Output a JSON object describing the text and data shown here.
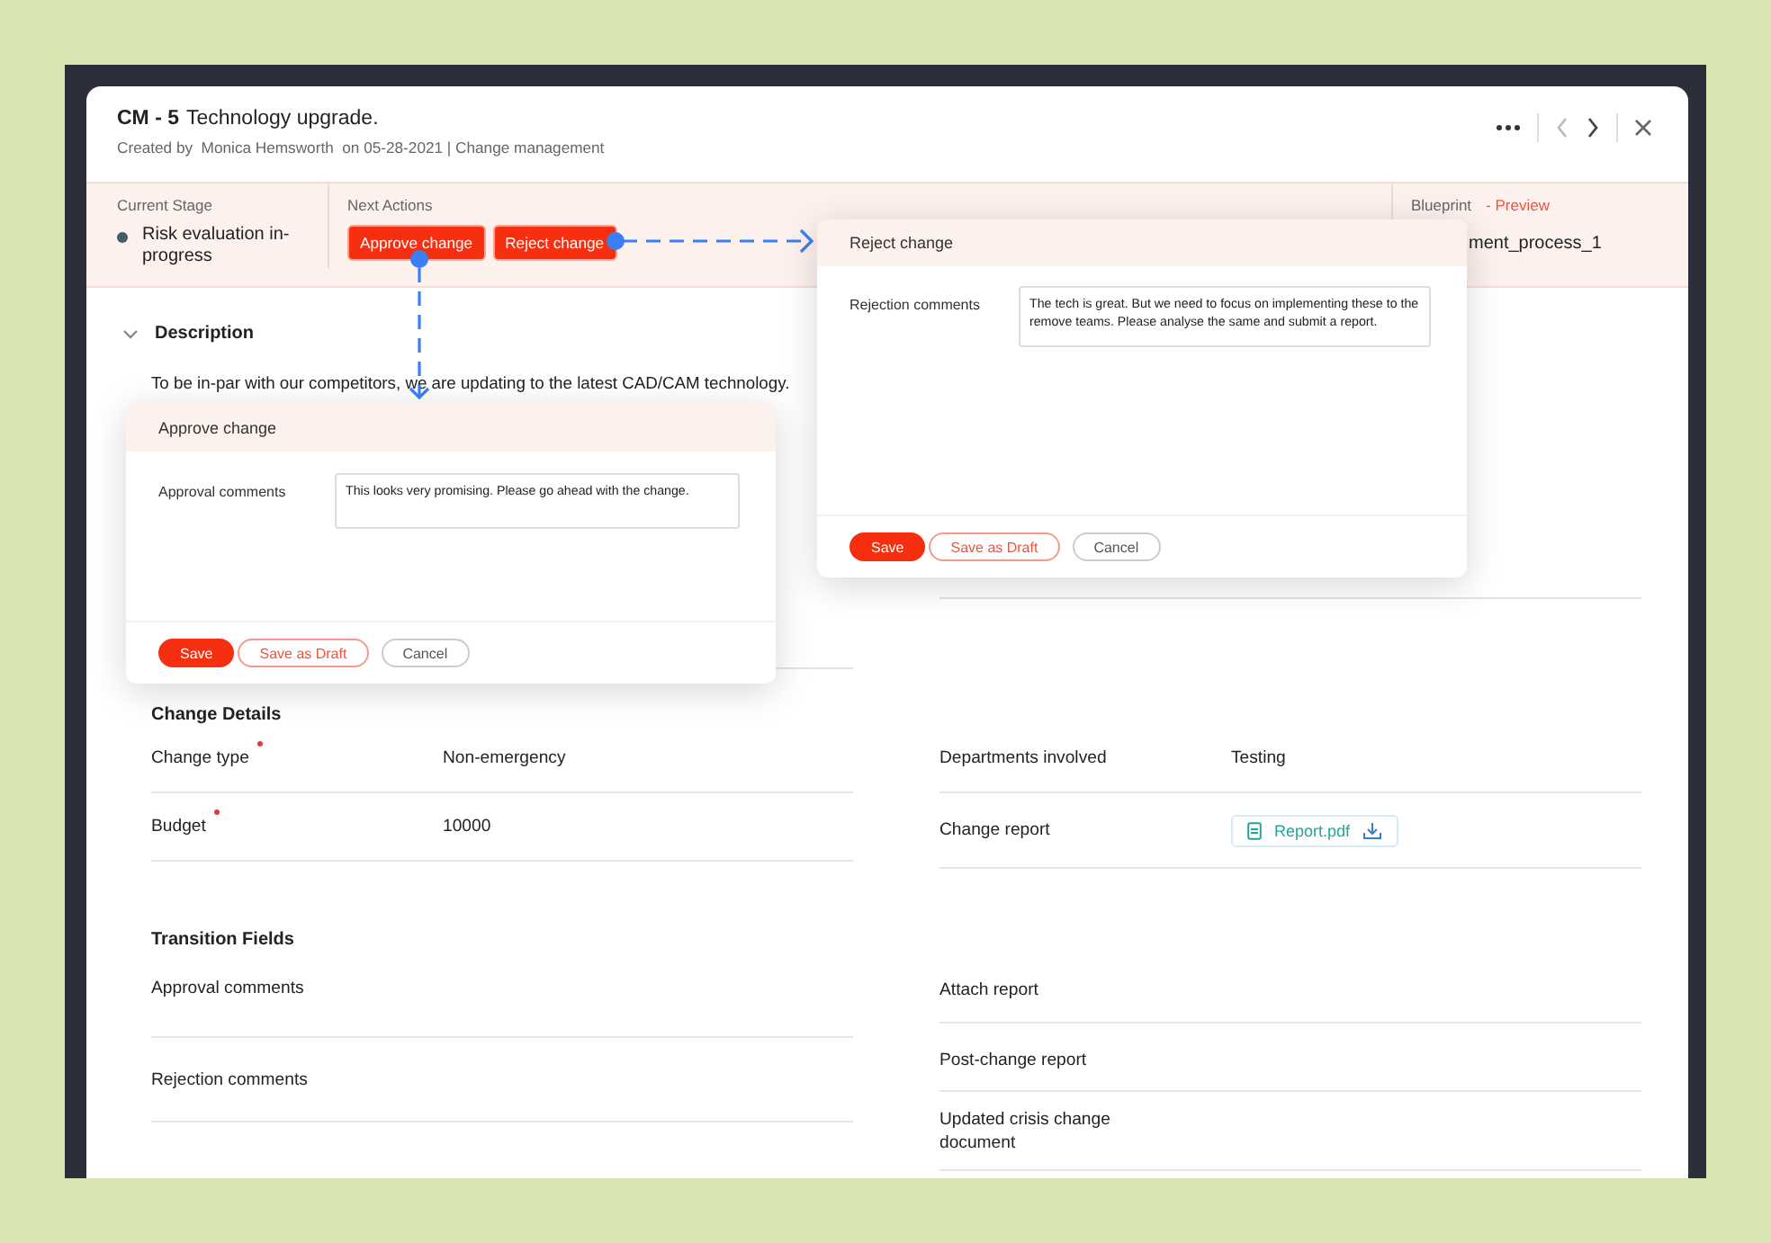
{
  "header": {
    "code": "CM - 5",
    "title": "Technology upgrade.",
    "subtitle": "Created by  Monica Hemsworth  on 05-28-2021 | Change management"
  },
  "stage": {
    "current_label": "Current Stage",
    "current": "Risk evaluation in-progress",
    "actions_label": "Next Actions",
    "actions": [
      "Approve change",
      "Reject change"
    ],
    "blueprint_label": "Blueprint",
    "preview_link": "- Preview",
    "blueprint_value": "ment_process_1"
  },
  "description": {
    "heading": "Description",
    "expanded": true,
    "text": "To be in-par with our competitors, we are updating to the latest CAD/CAM technology."
  },
  "change_details": {
    "heading": "Change Details",
    "left": [
      {
        "label": "Change type",
        "required": true,
        "value": "Non-emergency",
        "kind": "text"
      },
      {
        "label": "Budget",
        "required": true,
        "value": "10000",
        "kind": "text"
      }
    ],
    "right": [
      {
        "label": "Departments involved",
        "required": false,
        "value": "Testing",
        "kind": "text"
      },
      {
        "label": "Change report",
        "required": false,
        "value": "Report.pdf",
        "kind": "file"
      }
    ]
  },
  "transition_fields": {
    "heading": "Transition Fields",
    "left": [
      {
        "label": "Approval comments"
      },
      {
        "label": "Rejection comments"
      }
    ],
    "right": [
      {
        "label": "Attach report"
      },
      {
        "label": "Post-change report"
      },
      {
        "label": "Updated crisis change document"
      }
    ]
  },
  "dialogs": [
    {
      "title": "Reject change",
      "field_label": "Rejection comments",
      "value": "The tech is great. But we need to focus on implementing these to the remove teams. Please analyse the same and submit a report.",
      "buttons": [
        {
          "label": "Save",
          "kind": "primary"
        },
        {
          "label": "Save as Draft",
          "kind": "outline"
        },
        {
          "label": "Cancel",
          "kind": "plain"
        }
      ]
    },
    {
      "title": "Approve change",
      "field_label": "Approval comments",
      "value": "This looks very promising. Please go ahead with the change.",
      "buttons": [
        {
          "label": "Save",
          "kind": "primary"
        },
        {
          "label": "Save as Draft",
          "kind": "outline"
        },
        {
          "label": "Cancel",
          "kind": "plain"
        }
      ]
    }
  ]
}
